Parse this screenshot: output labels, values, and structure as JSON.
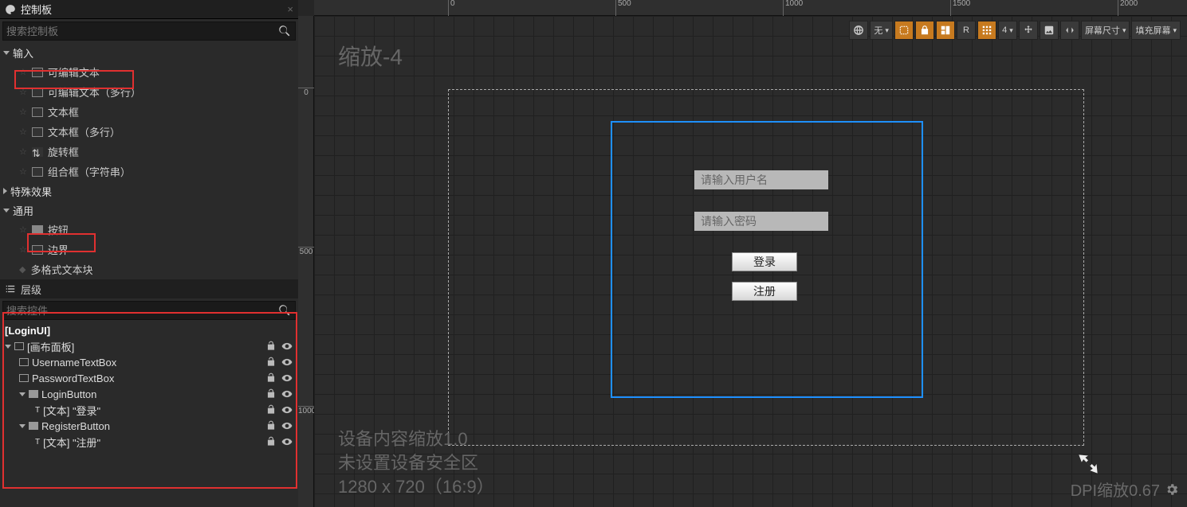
{
  "palette": {
    "tab_title": "控制板",
    "search_placeholder": "搜索控制板",
    "cat_input": "输入",
    "items_input": [
      "可编辑文本",
      "可编辑文本（多行）",
      "文本框",
      "文本框（多行）",
      "旋转框",
      "组合框（字符串）"
    ],
    "cat_special": "特殊效果",
    "cat_general": "通用",
    "items_general": [
      "按钮",
      "边界",
      "多格式文本块"
    ]
  },
  "hierarchy": {
    "tab_title": "层级",
    "search_placeholder": "搜索控件",
    "root": "[LoginUI]",
    "canvas_panel": "[画布面板]",
    "items": [
      "UsernameTextBox",
      "PasswordTextBox",
      "LoginButton",
      "[文本] \"登录\"",
      "RegisterButton",
      "[文本] \"注册\""
    ]
  },
  "viewport": {
    "zoom_label": "缩放-4",
    "ruler_h": [
      "0",
      "500",
      "1000",
      "1500",
      "2000"
    ],
    "ruler_v": [
      "0",
      "500",
      "1000"
    ],
    "username_placeholder": "请输入用户名",
    "password_placeholder": "请输入密码",
    "login_btn": "登录",
    "register_btn": "注册",
    "device_scale": "设备内容缩放1.0",
    "device_safe": "未设置设备安全区",
    "device_res": "1280 x 720（16:9）",
    "dpi": "DPI缩放0.67"
  },
  "toolbar": {
    "none": "无",
    "grid_num": "4",
    "screen_size": "屏幕尺寸",
    "fill_screen": "填充屏幕"
  }
}
